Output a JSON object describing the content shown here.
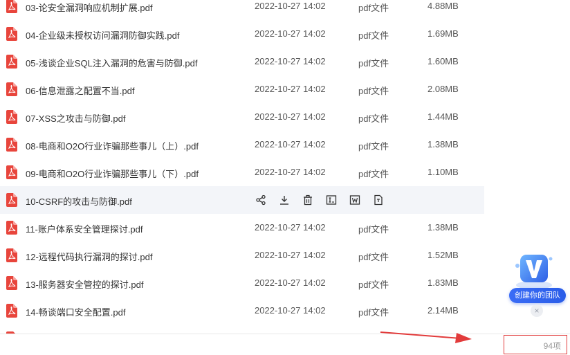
{
  "files": [
    {
      "name": "03-论安全漏洞响应机制扩展.pdf",
      "date": "2022-10-27 14:02",
      "type": "pdf文件",
      "size": "4.88MB"
    },
    {
      "name": "04-企业级未授权访问漏洞防御实践.pdf",
      "date": "2022-10-27 14:02",
      "type": "pdf文件",
      "size": "1.69MB"
    },
    {
      "name": "05-浅谈企业SQL注入漏洞的危害与防御.pdf",
      "date": "2022-10-27 14:02",
      "type": "pdf文件",
      "size": "1.60MB"
    },
    {
      "name": "06-信息泄露之配置不当.pdf",
      "date": "2022-10-27 14:02",
      "type": "pdf文件",
      "size": "2.08MB"
    },
    {
      "name": "07-XSS之攻击与防御.pdf",
      "date": "2022-10-27 14:02",
      "type": "pdf文件",
      "size": "1.44MB"
    },
    {
      "name": "08-电商和O2O行业诈骗那些事儿（上）.pdf",
      "date": "2022-10-27 14:02",
      "type": "pdf文件",
      "size": "1.38MB"
    },
    {
      "name": "09-电商和O2O行业诈骗那些事儿（下）.pdf",
      "date": "2022-10-27 14:02",
      "type": "pdf文件",
      "size": "1.10MB"
    },
    {
      "name": "10-CSRF的攻击与防御.pdf",
      "hovered": true
    },
    {
      "name": "11-账户体系安全管理探讨.pdf",
      "date": "2022-10-27 14:02",
      "type": "pdf文件",
      "size": "1.38MB"
    },
    {
      "name": "12-远程代码执行漏洞的探讨.pdf",
      "date": "2022-10-27 14:02",
      "type": "pdf文件",
      "size": "1.52MB"
    },
    {
      "name": "13-服务器安全管控的探讨.pdf",
      "date": "2022-10-27 14:02",
      "type": "pdf文件",
      "size": "1.83MB"
    },
    {
      "name": "14-畅谈端口安全配置.pdf",
      "date": "2022-10-27 14:02",
      "type": "pdf文件",
      "size": "2.14MB"
    }
  ],
  "row_actions": [
    "share-icon",
    "download-icon",
    "delete-icon",
    "rename-icon",
    "word-icon",
    "file-info-icon"
  ],
  "footer": {
    "item_count": "94项"
  },
  "team_widget": {
    "button_label": "创建你的团队",
    "close_glyph": "×"
  },
  "colors": {
    "pdf": "#e8453c",
    "accent": "#3a6cf6",
    "highlight_box": "#e23b3b"
  }
}
